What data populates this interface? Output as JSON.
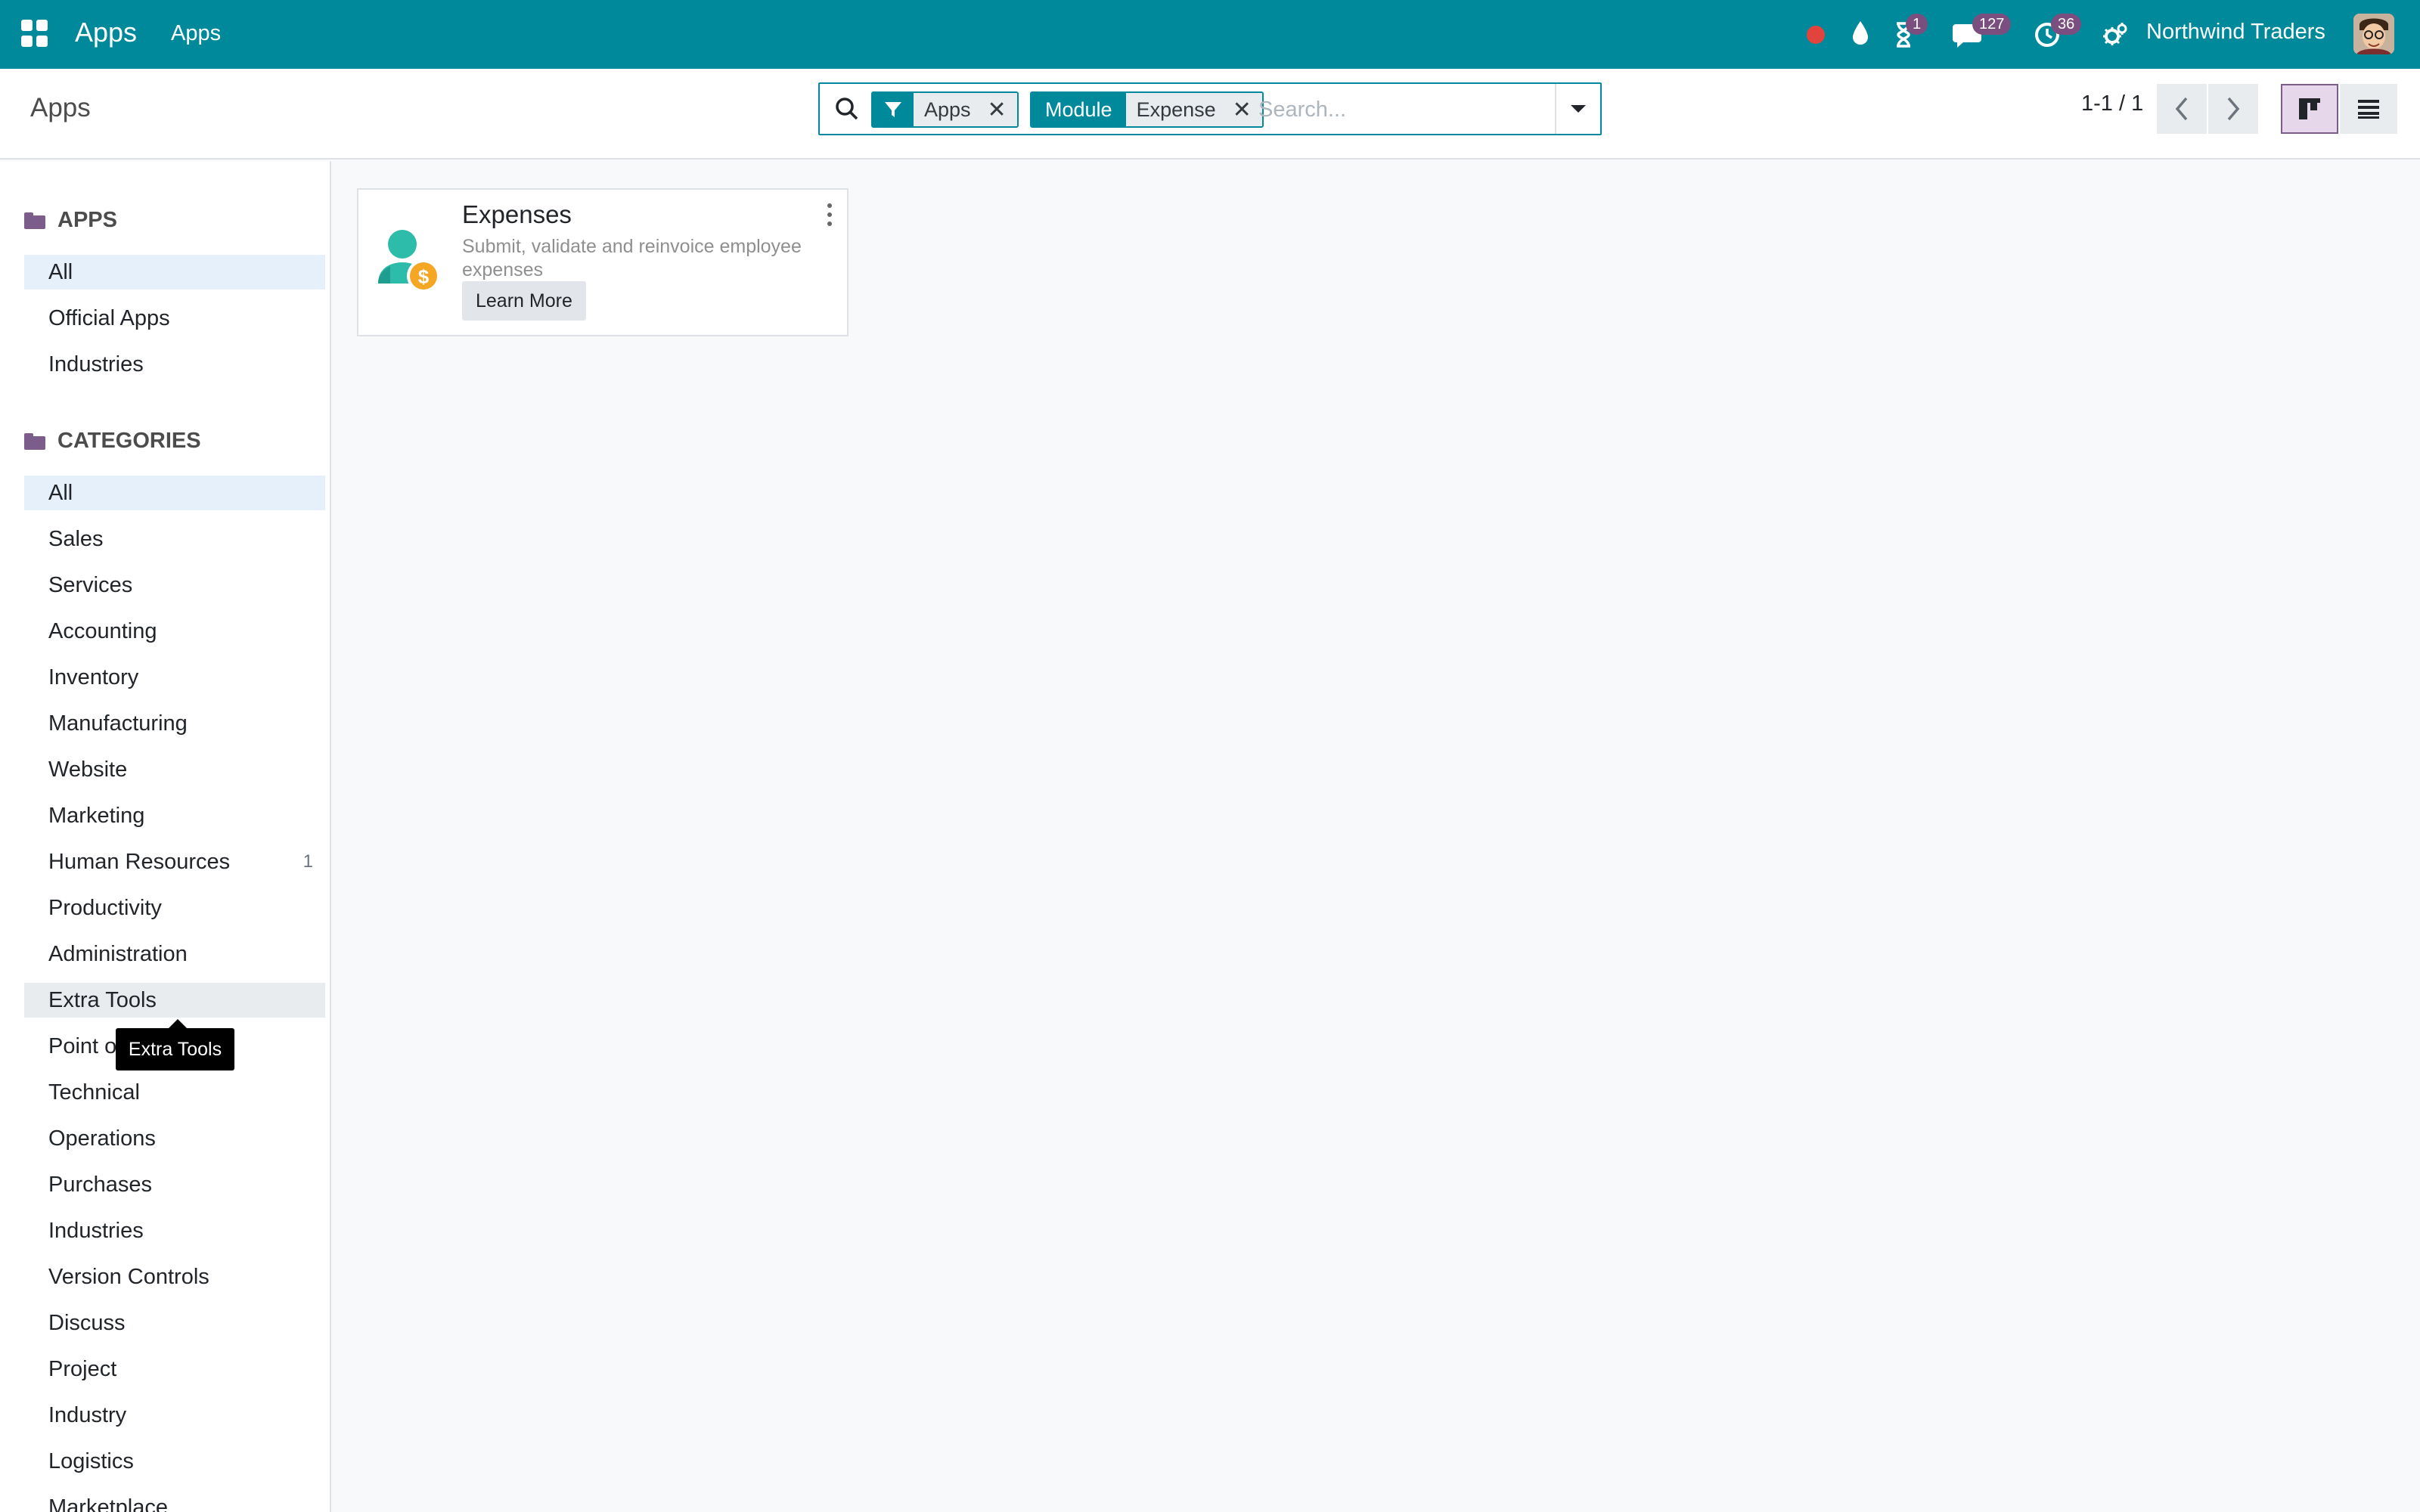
{
  "navbar": {
    "brand": "Apps",
    "menu_item": "Apps",
    "activity_badge": "1",
    "messages_badge": "127",
    "clock_badge": "36",
    "company": "Northwind Traders",
    "accent_color": "#00899a",
    "badge_color": "#7a4e7f"
  },
  "control_panel": {
    "breadcrumb": "Apps",
    "search": {
      "placeholder": "Search...",
      "value": "",
      "facets": [
        {
          "label": "",
          "icon": "filter-icon",
          "value": "Apps"
        },
        {
          "label": "Module",
          "value": "Expense"
        }
      ]
    },
    "pager": "1-1 / 1",
    "views": [
      "kanban-view-icon",
      "list-view-icon"
    ],
    "active_view": "kanban"
  },
  "sidebar": {
    "apps_header": "APPS",
    "apps_items": [
      {
        "label": "All",
        "active": true
      },
      {
        "label": "Official Apps"
      },
      {
        "label": "Industries"
      }
    ],
    "categories_header": "CATEGORIES",
    "categories_items": [
      {
        "label": "All",
        "active": true
      },
      {
        "label": "Sales"
      },
      {
        "label": "Services"
      },
      {
        "label": "Accounting"
      },
      {
        "label": "Inventory"
      },
      {
        "label": "Manufacturing"
      },
      {
        "label": "Website"
      },
      {
        "label": "Marketing"
      },
      {
        "label": "Human Resources",
        "count": "1"
      },
      {
        "label": "Productivity"
      },
      {
        "label": "Administration"
      },
      {
        "label": "Extra Tools",
        "hover": true
      },
      {
        "label": "Point of Sale"
      },
      {
        "label": "Technical"
      },
      {
        "label": "Operations"
      },
      {
        "label": "Purchases"
      },
      {
        "label": "Industries"
      },
      {
        "label": "Version Controls"
      },
      {
        "label": "Discuss"
      },
      {
        "label": "Project"
      },
      {
        "label": "Industry"
      },
      {
        "label": "Logistics"
      },
      {
        "label": "Marketplace"
      }
    ],
    "tooltip": "Extra Tools"
  },
  "kanban": {
    "cards": [
      {
        "title": "Expenses",
        "description": "Submit, validate and reinvoice employee expenses",
        "button": "Learn More",
        "icon": "expenses-icon"
      }
    ]
  }
}
